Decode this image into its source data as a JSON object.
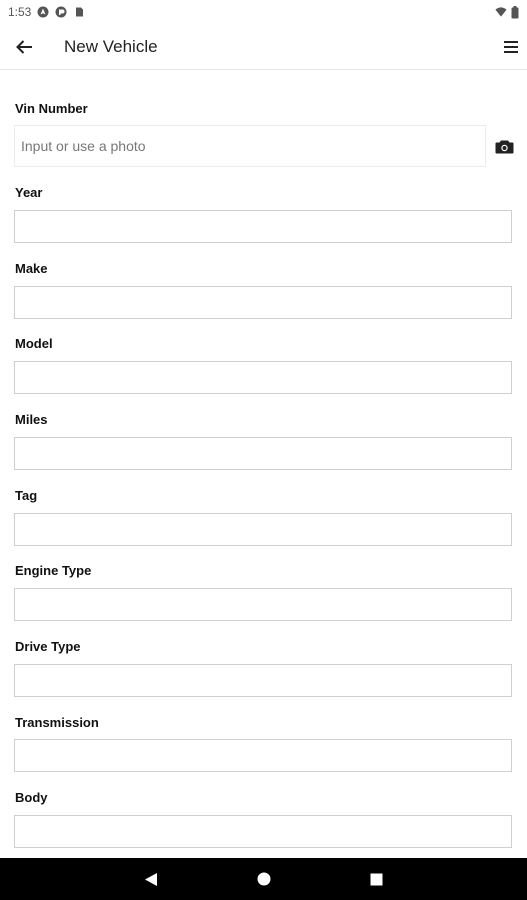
{
  "status_bar": {
    "time": "1:53",
    "icons_left": [
      "location-icon",
      "app-icon",
      "sd-card-icon"
    ],
    "icons_right": [
      "wifi-icon",
      "battery-icon"
    ]
  },
  "app_bar": {
    "back_icon": "arrow-left-icon",
    "title": "New Vehicle",
    "menu_icon": "hamburger-menu-icon"
  },
  "form": {
    "vin": {
      "label": "Vin Number",
      "value": "",
      "placeholder": "Input or use a photo",
      "action_icon": "camera-icon"
    },
    "fields": [
      {
        "label": "Year",
        "value": ""
      },
      {
        "label": "Make",
        "value": ""
      },
      {
        "label": "Model",
        "value": ""
      },
      {
        "label": "Miles",
        "value": ""
      },
      {
        "label": "Tag",
        "value": ""
      },
      {
        "label": "Engine Type",
        "value": ""
      },
      {
        "label": "Drive Type",
        "value": ""
      },
      {
        "label": "Transmission",
        "value": ""
      },
      {
        "label": "Body",
        "value": ""
      }
    ]
  },
  "nav_bar": {
    "buttons": [
      "back-triangle-icon",
      "home-circle-icon",
      "recents-square-icon"
    ]
  }
}
